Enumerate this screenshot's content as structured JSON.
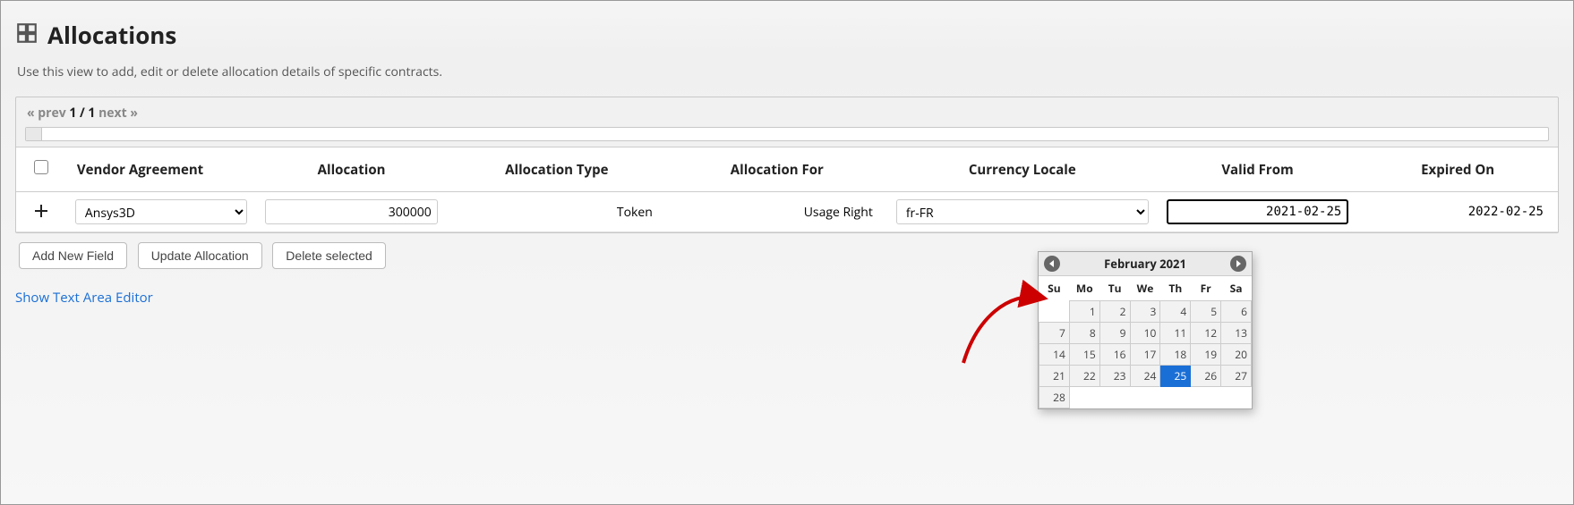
{
  "header": {
    "title": "Allocations",
    "subtitle": "Use this view to add, edit or delete allocation details of specific contracts."
  },
  "pager": {
    "prev": "« prev",
    "current": "1 / 1",
    "next": "next »"
  },
  "columns": {
    "vendor_agreement": "Vendor Agreement",
    "allocation": "Allocation",
    "allocation_type": "Allocation Type",
    "allocation_for": "Allocation For",
    "currency_locale": "Currency Locale",
    "valid_from": "Valid From",
    "expired_on": "Expired On"
  },
  "row": {
    "vendor_agreement": "Ansys3D",
    "allocation": "300000",
    "allocation_type": "Token",
    "allocation_for": "Usage Right",
    "currency_locale": "fr-FR",
    "valid_from": "2021-02-25",
    "expired_on": "2022-02-25"
  },
  "buttons": {
    "add_new_field": "Add New Field",
    "update_allocation": "Update Allocation",
    "delete_selected": "Delete selected"
  },
  "link": "Show Text Area Editor",
  "datepicker": {
    "month_label": "February 2021",
    "dow": [
      "Su",
      "Mo",
      "Tu",
      "We",
      "Th",
      "Fr",
      "Sa"
    ],
    "weeks": [
      [
        null,
        1,
        2,
        3,
        4,
        5,
        6
      ],
      [
        7,
        8,
        9,
        10,
        11,
        12,
        13
      ],
      [
        14,
        15,
        16,
        17,
        18,
        19,
        20
      ],
      [
        21,
        22,
        23,
        24,
        25,
        26,
        27
      ],
      [
        28,
        null,
        null,
        null,
        null,
        null,
        null
      ]
    ],
    "selected": 25
  }
}
